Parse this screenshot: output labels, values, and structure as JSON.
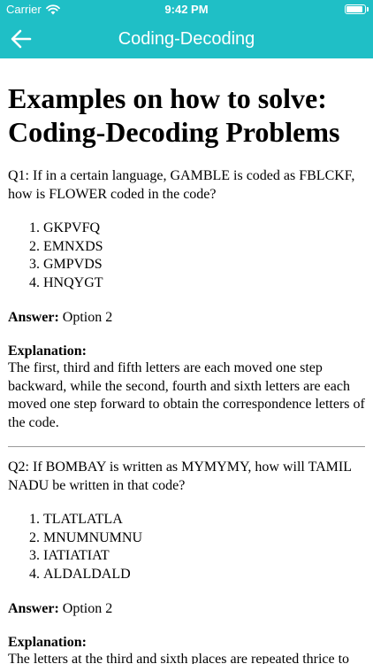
{
  "status_bar": {
    "carrier": "Carrier",
    "time": "9:42 PM",
    "wifi_icon": "wifi-icon",
    "battery_icon": "battery-icon"
  },
  "nav": {
    "back_icon": "arrow-left-icon",
    "title": "Coding-Decoding"
  },
  "page": {
    "heading": "Examples on how to solve: Coding-Decoding Problems",
    "questions": [
      {
        "question": "Q1: If in a certain language, GAMBLE is coded as FBLCKF, how is FLOWER coded in the code?",
        "options": [
          "GKPVFQ",
          "EMNXDS",
          "GMPVDS",
          "HNQYGT"
        ],
        "answer_label": "Answer:",
        "answer_value": "Option 2",
        "explanation_label": "Explanation:",
        "explanation": "The first, third and fifth letters are each moved one step backward, while the second, fourth and sixth letters are each moved one step forward to obtain the correspondence letters of the code."
      },
      {
        "question": "Q2: If BOMBAY is written as MYMYMY, how will TAMIL NADU be written in that code?",
        "options": [
          "TLATLATLA",
          "MNUMNUMNU",
          "IATIATIAT",
          "ALDALDALD"
        ],
        "answer_label": "Answer:",
        "answer_value": "Option 2",
        "explanation_label": "Explanation:",
        "explanation": "The letters at the third and sixth places are repeated thrice to code BOMBAY as MYMYMY."
      }
    ]
  },
  "colors": {
    "accent": "#1fbfc6",
    "text": "#000000",
    "divider": "#9a9a9a"
  }
}
